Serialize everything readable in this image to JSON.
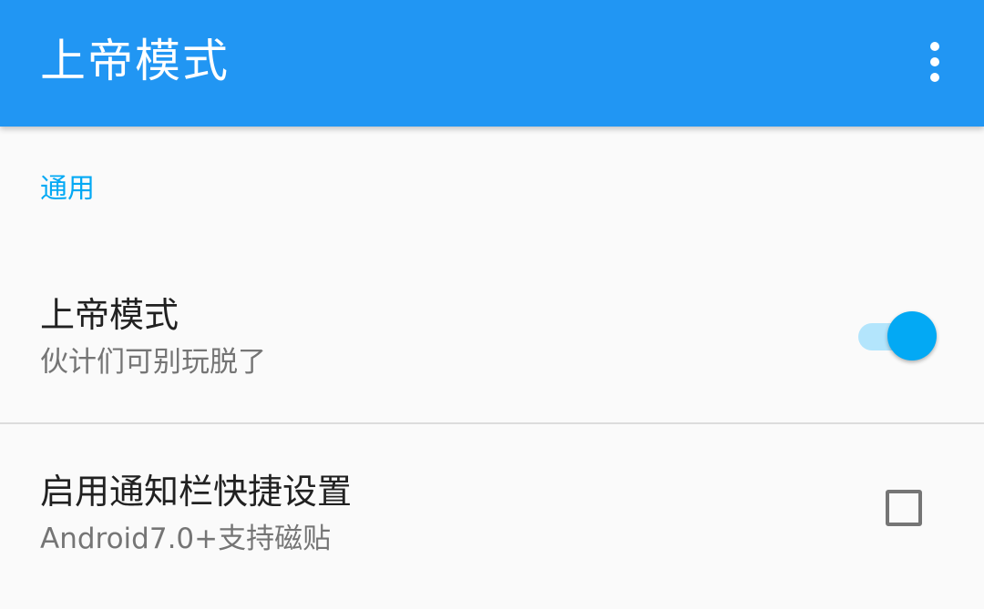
{
  "appbar": {
    "title": "上帝模式",
    "overflow_icon": "more-vert-icon",
    "background": "#2196f3"
  },
  "sections": [
    {
      "header": "通用",
      "items": [
        {
          "title": "上帝模式",
          "summary": "伙计们可别玩脱了",
          "control": "switch",
          "checked": true
        },
        {
          "title": "启用通知栏快捷设置",
          "summary": "Android7.0+支持磁贴",
          "control": "checkbox",
          "checked": false
        }
      ]
    }
  ],
  "colors": {
    "accent": "#03a9f4",
    "primary": "#2196f3",
    "switch_track": "#b3e5fc",
    "text_primary": "#212121",
    "text_secondary": "#757575"
  }
}
